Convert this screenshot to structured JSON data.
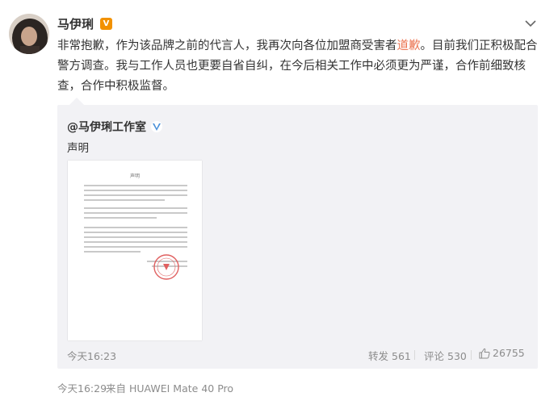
{
  "post": {
    "author": "马伊琍",
    "badge_icon": "v-verified-badge-icon",
    "text_1": "非常抱歉，作为该品牌之前的代言人，我再次向各位加盟商受害者",
    "keyword": "道歉",
    "text_2": "。目前我们正积极配合警方调查。我与工作人员也更要自省自纠，在今后相关工作中必须更为严谨，合作前细致核查，合作中积极监督。",
    "time": "今天16:29",
    "source": "来自 HUAWEI Mate 40 Pro"
  },
  "quote": {
    "author": "@马伊琍工作室",
    "text": "声明",
    "image_title": "声明",
    "time": "今天16:23",
    "repost_label": "转发",
    "repost_count": "561",
    "comment_label": "评论",
    "comment_count": "530",
    "like_count": "26755"
  },
  "colors": {
    "keyword": "#eb7350",
    "orange_badge": "#f29100",
    "blue_badge": "#4a90d9",
    "quote_bg": "#f2f2f5",
    "meta_text": "#8c8c8c"
  }
}
